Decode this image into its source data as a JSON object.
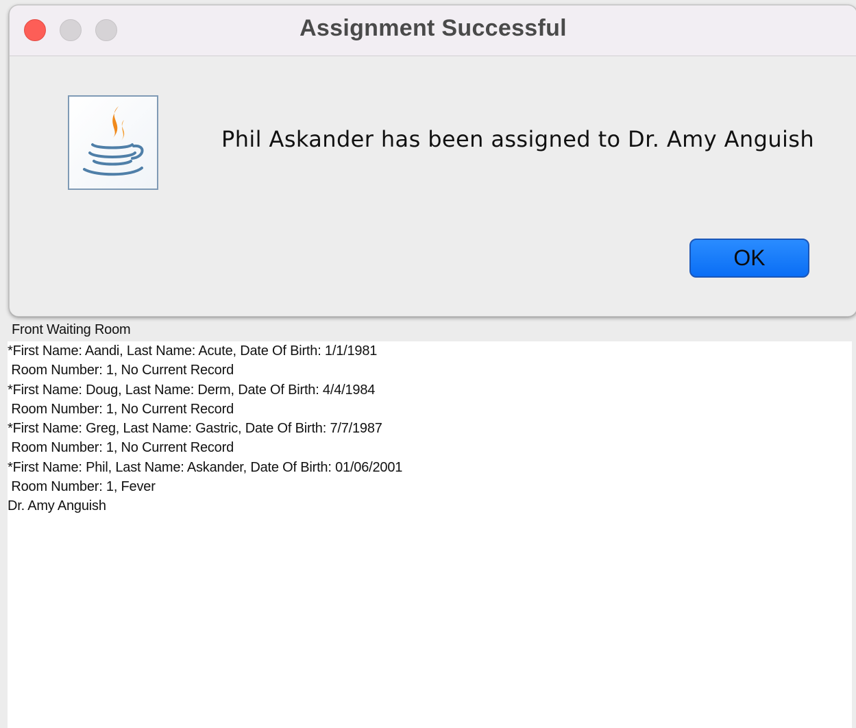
{
  "dialog": {
    "title": "Assignment Successful",
    "message": "Phil Askander has been assigned to Dr. Amy Anguish",
    "ok_label": "OK",
    "icon": "java-coffee-cup-icon"
  },
  "window_controls": {
    "close_color": "#fd5e57",
    "inactive_color": "#d6d3d6"
  },
  "main": {
    "panel_title": "Front Waiting Room",
    "lines": [
      "*First Name: Aandi, Last Name: Acute, Date Of Birth: 1/1/1981",
      " Room Number: 1, No Current Record",
      "*First Name: Doug, Last Name: Derm, Date Of Birth: 4/4/1984",
      " Room Number: 1, No Current Record",
      "*First Name: Greg, Last Name: Gastric, Date Of Birth: 7/7/1987",
      " Room Number: 1, No Current Record",
      "*First Name: Phil, Last Name: Askander, Date Of Birth: 01/06/2001",
      " Room Number: 1, Fever",
      "Dr. Amy Anguish"
    ]
  },
  "colors": {
    "ok_button": "#0a6ef5",
    "dialog_bg": "#ededed",
    "titlebar_bg": "#f2eef3"
  }
}
